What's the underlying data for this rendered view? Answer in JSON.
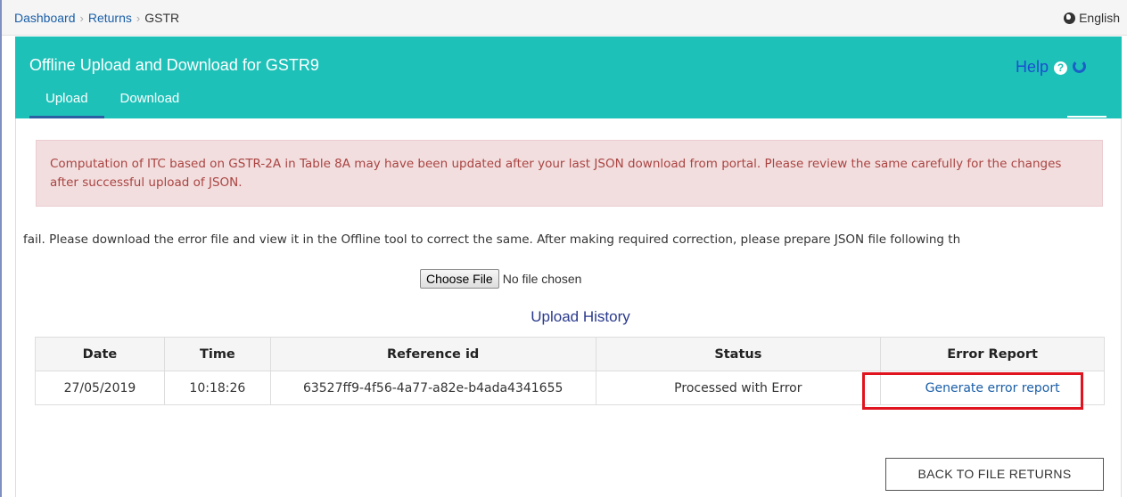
{
  "breadcrumb": {
    "items": [
      "Dashboard",
      "Returns",
      "GSTR"
    ]
  },
  "language": "English",
  "header": {
    "title": "Offline Upload and Download for GSTR9",
    "help_label": "Help",
    "tabs": [
      {
        "label": "Upload",
        "active": true
      },
      {
        "label": "Download",
        "active": false
      }
    ]
  },
  "alert": {
    "text": "Computation of ITC based on GSTR-2A in Table 8A may have been updated after your last JSON download from portal. Please review the same carefully for the changes after successful upload of JSON."
  },
  "info_text": "fail. Please download the error file and view it in the Offline tool to correct the same. After making required correction, please prepare JSON file following th",
  "file_input": {
    "button_label": "Choose File",
    "status": "No file chosen"
  },
  "upload_history": {
    "title": "Upload History",
    "columns": [
      "Date",
      "Time",
      "Reference id",
      "Status",
      "Error Report"
    ],
    "rows": [
      {
        "date": "27/05/2019",
        "time": "10:18:26",
        "reference_id": "63527ff9-4f56-4a77-a82e-b4ada4341655",
        "status": "Processed with Error",
        "error_report": "Generate error report"
      }
    ]
  },
  "back_button_label": "BACK TO FILE RETURNS",
  "colors": {
    "header_bg": "#1ec1b8",
    "alert_bg": "#f2dede",
    "alert_text": "#a94442",
    "link": "#1a5fa8",
    "highlight_box": "#e0141e"
  }
}
